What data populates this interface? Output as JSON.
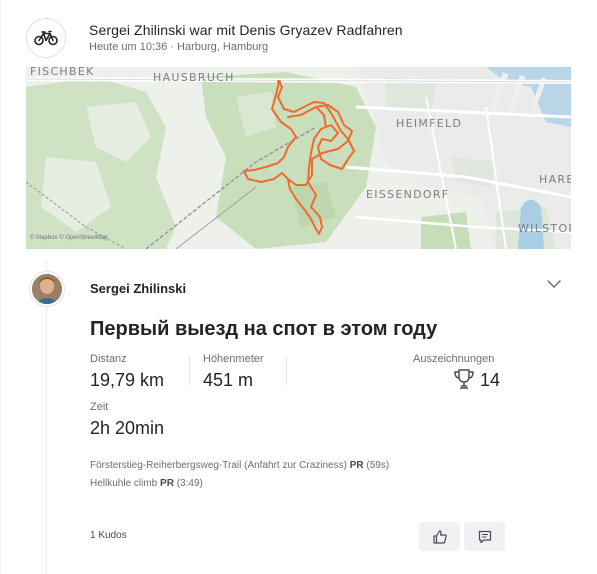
{
  "header": {
    "title": "Sergei Zhilinski war mit Denis Gryazev Radfahren",
    "subtitle": "Heute um 10:36 · Harburg, Hamburg",
    "sport_icon": "bicycle-icon"
  },
  "map": {
    "labels": {
      "fischbek": "FISCHBEK",
      "hausbruch": "HAUSBRUCH",
      "heimfeld": "HEIMFELD",
      "eissendorf": "EISSENDORF",
      "harb": "HARB",
      "wilstorf": "WILSTORF"
    },
    "attribution": "© Mapbox © OpenStreetMap",
    "route_color": "#f06a2e"
  },
  "athlete": {
    "name": "Sergei Zhilinski",
    "avatar_icon": "avatar"
  },
  "activity": {
    "title": "Первый выезд на спот в этом году",
    "stats": {
      "distance_label": "Distanz",
      "distance_value": "19,79 km",
      "elevation_label": "Höhenmeter",
      "elevation_value": "451 m",
      "time_label": "Zeit",
      "time_value": "2h 20min",
      "achievements_label": "Auszeichnungen",
      "achievements_value": "14"
    },
    "segments": [
      {
        "name": "Försterstieg-Reiherbergsweg-Trail (Anfahrt zur Craziness)",
        "badge": "PR",
        "time": "(59s)"
      },
      {
        "name": "Hellkuhle climb",
        "badge": "PR",
        "time": "(3:49)"
      }
    ]
  },
  "footer": {
    "kudos": "1 Kudos"
  },
  "colors": {
    "accent": "#f06a2e",
    "text_primary": "#242428",
    "text_secondary": "#6d6d78"
  }
}
